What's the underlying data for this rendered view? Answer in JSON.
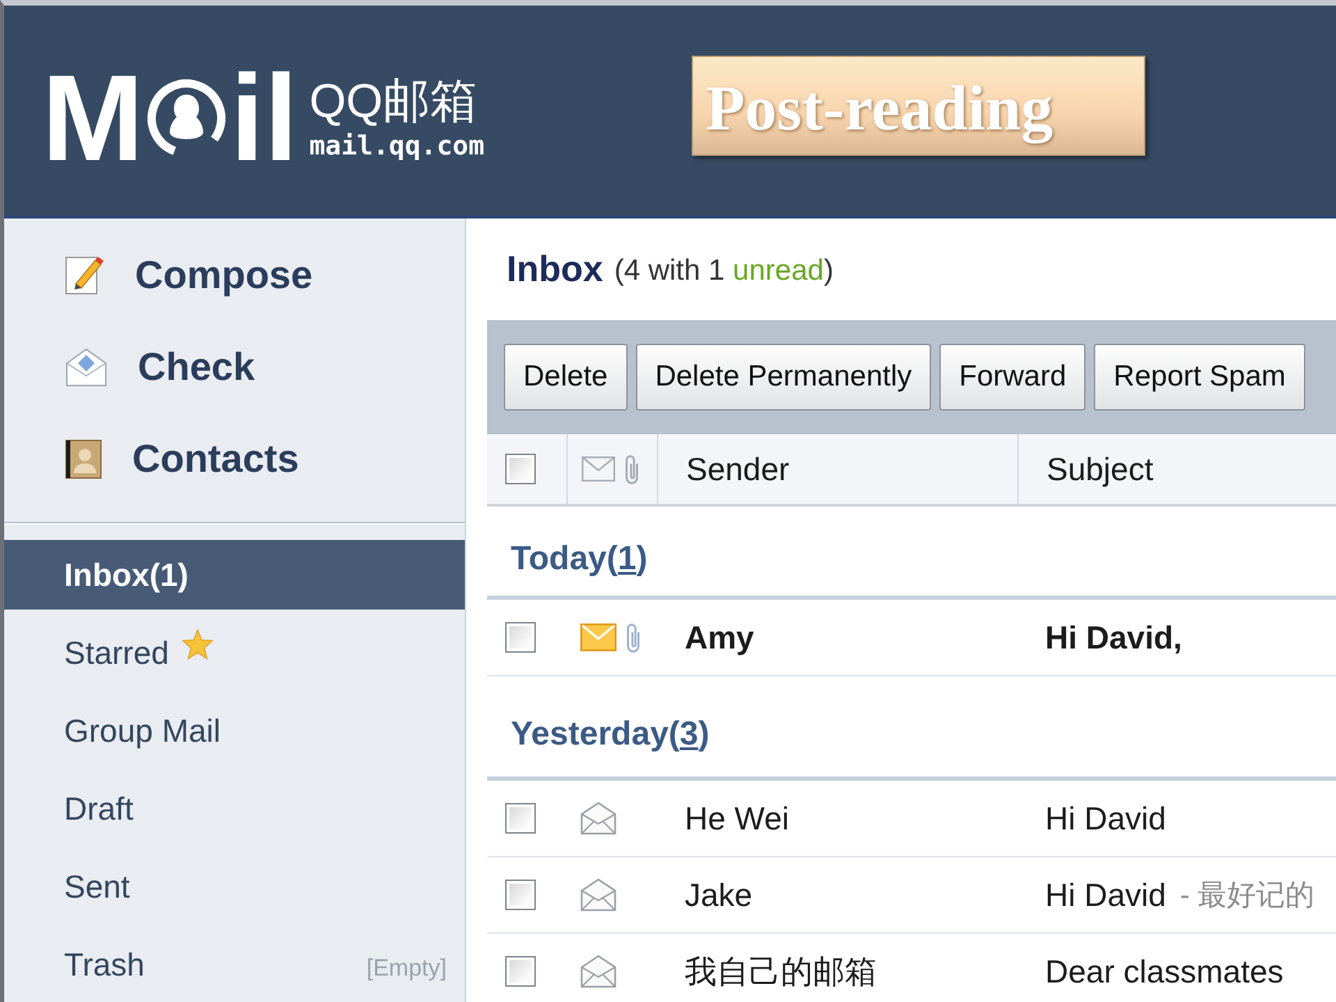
{
  "header": {
    "logo": {
      "letter_left": "M",
      "letters_right": "il",
      "product_name": "QQ邮箱",
      "domain": "mail.qq.com"
    },
    "banner": "Post-reading"
  },
  "sidebar": {
    "actions": [
      {
        "kind": "compose",
        "label": "Compose"
      },
      {
        "kind": "check",
        "label": "Check"
      },
      {
        "kind": "contacts",
        "label": "Contacts"
      }
    ],
    "folders": [
      {
        "label": "Inbox(1)",
        "selected": true,
        "kind": "plain"
      },
      {
        "label": "Starred",
        "selected": false,
        "kind": "starred"
      },
      {
        "label": "Group Mail",
        "selected": false,
        "kind": "plain"
      },
      {
        "label": "Draft",
        "selected": false,
        "kind": "plain"
      },
      {
        "label": "Sent",
        "selected": false,
        "kind": "plain"
      },
      {
        "label": "Trash",
        "selected": false,
        "kind": "plain",
        "note": "[Empty]"
      }
    ]
  },
  "mailbox": {
    "title": "Inbox",
    "summary_before": "(4 with 1",
    "unread_link": "unread",
    "summary_after": ")"
  },
  "toolbar": {
    "buttons": [
      "Delete",
      "Delete Permanently",
      "Forward",
      "Report Spam"
    ]
  },
  "table": {
    "select_all": {
      "checked": false
    },
    "columns": [
      "Sender",
      "Subject"
    ],
    "groups": [
      {
        "title_before": "Today(",
        "count": "1",
        "title_after": ")",
        "messages": [
          {
            "checked": false,
            "unread": true,
            "has_attachment": true,
            "sender": "Amy",
            "subject": "Hi David,"
          }
        ]
      },
      {
        "title_before": "Yesterday(",
        "count": "3",
        "title_after": ")",
        "messages": [
          {
            "checked": false,
            "unread": false,
            "has_attachment": false,
            "sender": "He Wei",
            "subject": "Hi David"
          },
          {
            "checked": false,
            "unread": false,
            "has_attachment": false,
            "sender": "Jake",
            "subject": "Hi David",
            "preview": "- 最好记的"
          },
          {
            "checked": false,
            "unread": false,
            "has_attachment": false,
            "sender": "我自己的邮箱",
            "subject": "Dear classmates"
          }
        ]
      }
    ]
  }
}
